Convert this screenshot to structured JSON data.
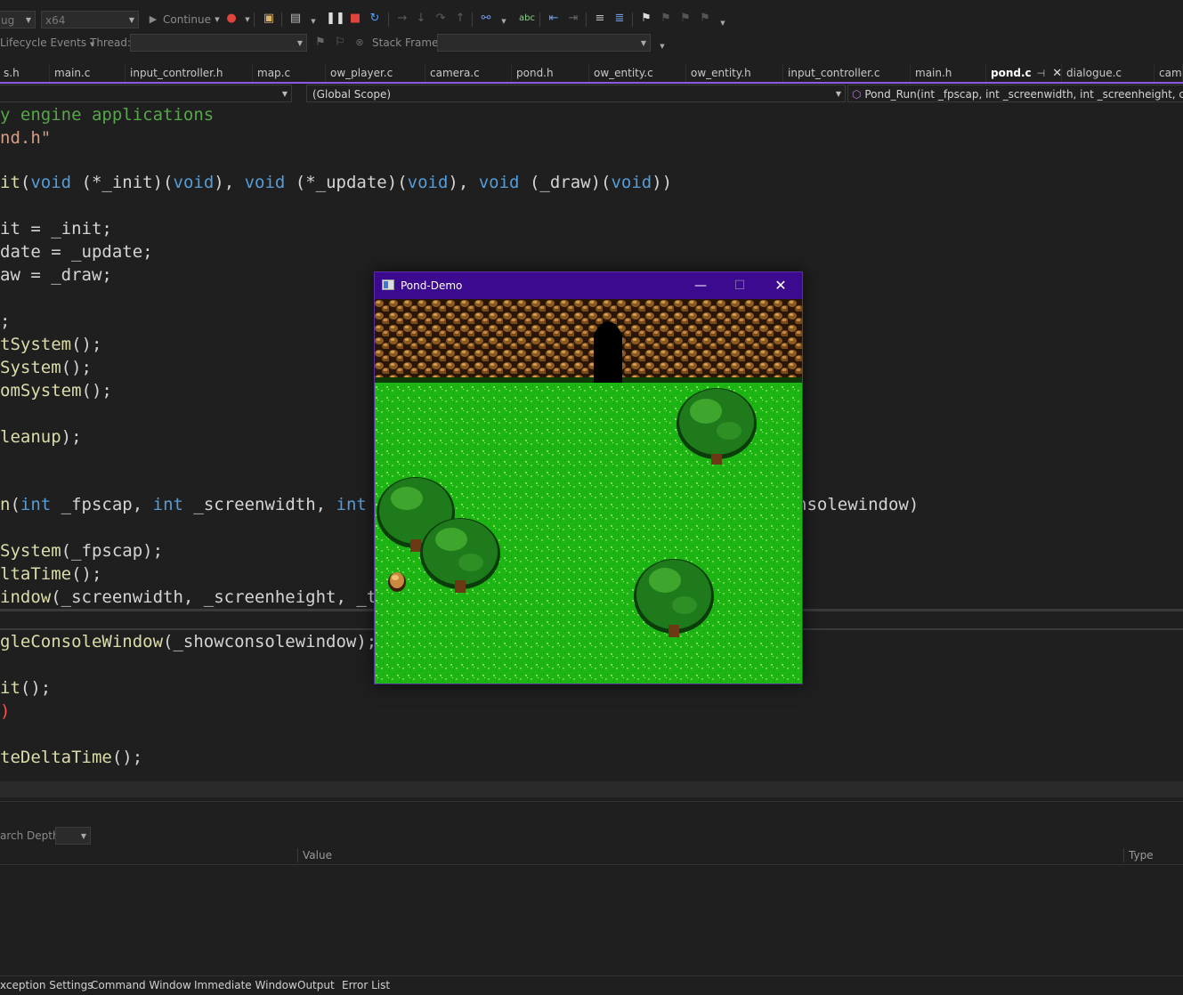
{
  "toolbar": {
    "config_combo": "ug",
    "platform_combo": "x64",
    "continue_label": "Continue",
    "lifecycle_label": "Lifecycle Events",
    "thread_label": "Thread:",
    "thread_value": "",
    "stack_frame_label": "Stack Frame:",
    "stack_frame_value": ""
  },
  "tabs": [
    {
      "label": "s.h"
    },
    {
      "label": "main.c"
    },
    {
      "label": "input_controller.h"
    },
    {
      "label": "map.c"
    },
    {
      "label": "ow_player.c"
    },
    {
      "label": "camera.c"
    },
    {
      "label": "pond.h"
    },
    {
      "label": "ow_entity.c"
    },
    {
      "label": "ow_entity.h"
    },
    {
      "label": "input_controller.c"
    },
    {
      "label": "main.h"
    },
    {
      "label": "pond.c",
      "active": true
    },
    {
      "label": "dialogue.c"
    },
    {
      "label": "came"
    }
  ],
  "navbar": {
    "project_combo": "",
    "scope_combo": "(Global Scope)",
    "member_combo": "Pond_Run(int _fpscap, int _screenwidth, int _screenheight, char * _title"
  },
  "code": {
    "l1": "y engine applications",
    "l2a": "nd.h",
    "l2q": "\"",
    "l3a": "it",
    "l3b": "(",
    "l3c": "void",
    "l3d": " (*_init)(",
    "l3e": "void",
    "l3f": "), ",
    "l3g": "void",
    "l3h": " (*_update)(",
    "l3i": "void",
    "l3j": "), ",
    "l3k": "void",
    "l3l": " (_draw)(",
    "l3m": "void",
    "l3n": "))",
    "l4": "it = _init;",
    "l5": "date = _update;",
    "l6": "aw = _draw;",
    "l7": ";",
    "l8a": "tSystem",
    "l8b": "();",
    "l9a": "System",
    "l9b": "();",
    "l10a": "omSystem",
    "l10b": "();",
    "l11a": "leanup",
    "l11b": ");",
    "l12a": "n",
    "l12b": "(",
    "l12c": "int",
    "l12d": " _fpscap, ",
    "l12e": "int",
    "l12f": " _screenwidth, ",
    "l12g": "int",
    "l12h": "nsolewindow)",
    "l13a": "System",
    "l13b": "(_fpscap);",
    "l14a": "ltaTime",
    "l14b": "();",
    "l15a": "indow",
    "l15b": "(_screenwidth, _screenheight, _t",
    "l16a": "gleConsoleWindow",
    "l16b": "(_showconsolewindow);",
    "l17a": "it",
    "l17b": "();",
    "l18": ")",
    "l19a": "teDeltaTime",
    "l19b": "();"
  },
  "locals": {
    "search_depth_label": "arch Depth:",
    "col_value": "Value",
    "col_type": "Type"
  },
  "bottom_tabs": [
    {
      "label": "xception Settings"
    },
    {
      "label": "Command Window"
    },
    {
      "label": "Immediate Window"
    },
    {
      "label": "Output"
    },
    {
      "label": "Error List"
    }
  ],
  "game_window": {
    "title": "Pond-Demo",
    "minimize": "—",
    "maximize": "☐",
    "close": "✕"
  },
  "colors": {
    "accent": "#8a5be0",
    "game_titlebar": "#3c0a8f",
    "grass": "#1fb816",
    "rock": "#8a5a22"
  }
}
